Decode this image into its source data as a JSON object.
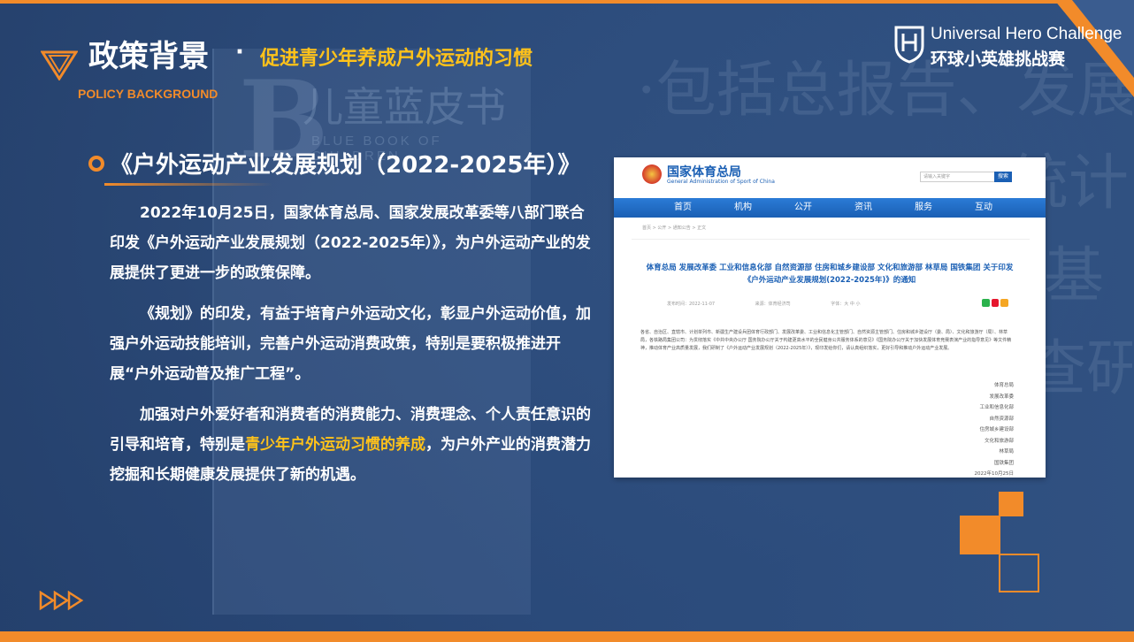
{
  "header": {
    "title": "政策背景",
    "separator": "·",
    "subtitle": "促进青少年养成户外运动的习惯",
    "title_en": "POLICY BACKGROUND"
  },
  "brand": {
    "name_en": "Universal Hero  Challenge",
    "name_cn": "环球小英雄挑战赛"
  },
  "section": {
    "title": "《户外运动产业发展规划（2022-2025年）》"
  },
  "paragraphs": {
    "p1": "2022年10月25日，国家体育总局、国家发展改革委等八部门联合印发《户外运动产业发展规划（2022-2025年）》，为户外运动产业的发展提供了更进一步的政策保障。",
    "p2": "《规划》的印发，有益于培育户外运动文化，彰显户外运动价值，加强户外运动技能培训，完善户外运动消费政策，特别是要积极推进开展“户外运动普及推广工程”。",
    "p3_before": "加强对户外爱好者和消费者的消费能力、消费理念、个人责任意识的引导和培育，特别是",
    "p3_highlight": "青少年户外运动习惯的养成",
    "p3_after": "，为户外产业的消费潜力挖掘和长期健康发展提供了新的机遇。"
  },
  "background": {
    "book_letter": "B",
    "book_title": "儿童蓝皮书",
    "book_title_en": "BLUE BOOK OF CHILDREN",
    "right_lines": [
      "·包括总报告、发展篇、",
      "统计",
      "基",
      "查研"
    ]
  },
  "webshot": {
    "site_name": "国家体育总局",
    "site_name_en": "General Administration of Sport of China",
    "search_placeholder": "请输入关键字",
    "search_button": "搜索",
    "nav": [
      "首页",
      "机构",
      "公开",
      "资讯",
      "服务",
      "互动"
    ],
    "breadcrumb": "首页 > 公开 > 通知公告 > 正文",
    "article_title": "体育总局 发展改革委 工业和信息化部 自然资源部 住房和城乡建设部 文化和旅游部 林草局 国铁集团 关于印发《户外运动产业发展规划(2022-2025年)》的通知",
    "meta": [
      "发布时间：2022-11-07",
      "来源：体育经济司",
      "字体：大 中 小"
    ],
    "body": "各省、自治区、直辖市、计划单列市、新疆生产建设兵团体育行政部门、发展改革委、工业和信息化主管部门、自然资源主管部门、住房和城乡建设厅（委、局）、文化和旅游厅（局）、林草局，各铁路局集团公司：为贯彻落实《中共中央办公厅 国务院办公厅关于构建更高水平的全民健身公共服务体系的意见》《国务院办公厅关于加快发展体育竞赛表演产业的指导意见》等文件精神，推动体育产业高质量发展，我们研制了《户外运动产业发展规划（2022-2025年）》，现印发给你们，请认真组织落实，更好引导和推动户外运动产业发展。",
    "signatures": [
      "体育总局",
      "发展改革委",
      "工业和信息化部",
      "自然资源部",
      "住房城乡建设部",
      "文化和旅游部",
      "林草局",
      "国铁集团",
      "2022年10月25日"
    ]
  },
  "colors": {
    "accent_orange": "#f28b2a",
    "highlight_yellow": "#ffc21a",
    "background_blue": "#2f4f7f",
    "web_blue": "#1a5fb4"
  }
}
